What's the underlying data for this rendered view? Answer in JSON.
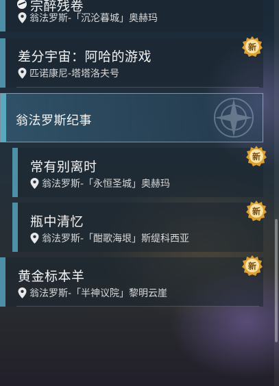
{
  "quests": [
    {
      "title": "宗醉残卷",
      "location": "翁法罗斯-「沉沦暮城」奥赫玛",
      "new": false
    },
    {
      "title": "差分宇宙：阿哈的游戏",
      "location": "匹诺康尼-塔塔洛夫号",
      "new": true
    }
  ],
  "section": {
    "title": "翁法罗斯纪事"
  },
  "sub_quests": [
    {
      "title": "常有别离时",
      "location": "翁法罗斯-「永恒圣城」奥赫玛",
      "new": true
    },
    {
      "title": "瓶中清忆",
      "location": "翁法罗斯-「酣歌海垠」斯缇科西亚",
      "new": true
    }
  ],
  "last_quest": {
    "title": "黄金标本羊",
    "location": "翁法罗斯-「半神议院」黎明云崖",
    "new": true
  },
  "badge_label": "新",
  "colors": {
    "accent_bar": "#4d8fa6",
    "badge": "#e0a030"
  }
}
